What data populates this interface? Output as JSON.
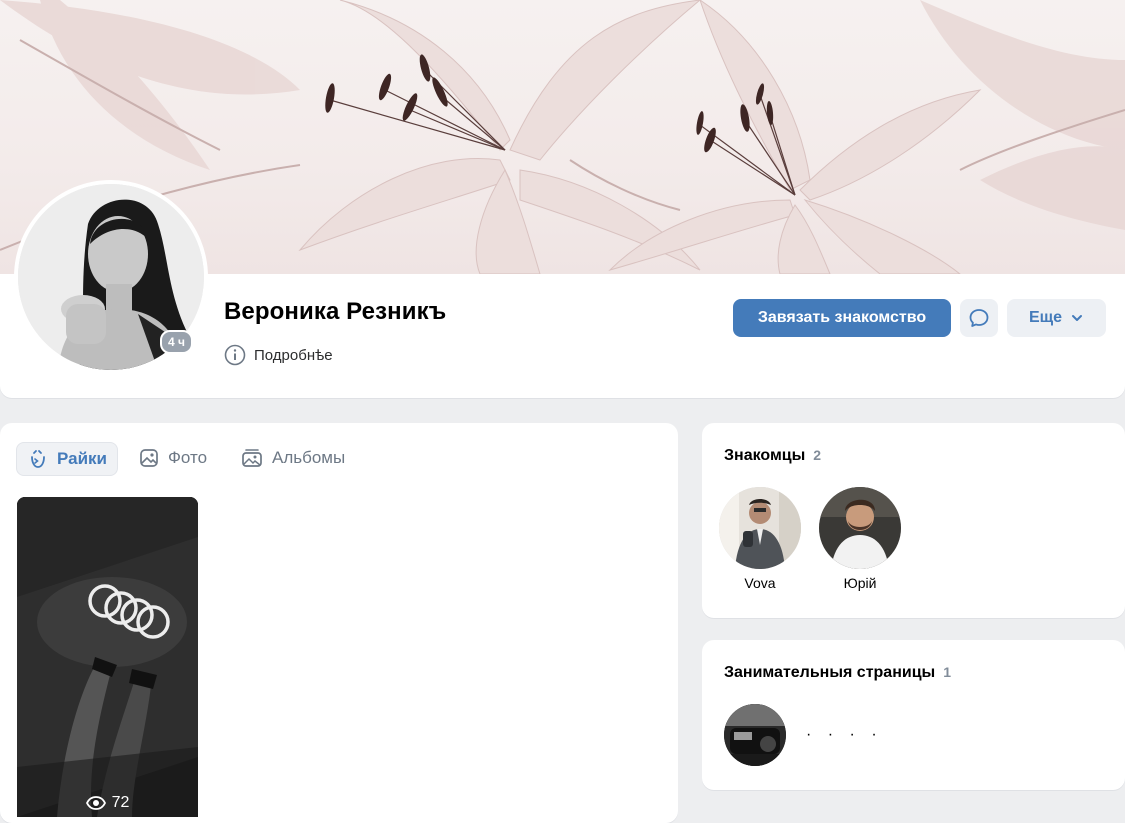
{
  "profile": {
    "name": "Вероника Резникъ",
    "details_label": "Подробнѣе",
    "online_badge": "4 ч",
    "actions": {
      "primary": "Завязать знакомство",
      "more": "Еще"
    }
  },
  "tabs": [
    {
      "label": "Райки",
      "icon": "clips-icon",
      "active": true
    },
    {
      "label": "Фото",
      "icon": "photo-icon",
      "active": false
    },
    {
      "label": "Альбомы",
      "icon": "albums-icon",
      "active": false
    }
  ],
  "clip": {
    "views": "72",
    "icon": "eye-icon"
  },
  "friends": {
    "title": "Знакомцы",
    "count": "2",
    "items": [
      {
        "name": "Vova"
      },
      {
        "name": "Юрій"
      }
    ]
  },
  "pages": {
    "title": "Занимательныя страницы",
    "count": "1",
    "items": [
      {
        "name": "· · · ·"
      }
    ]
  },
  "colors": {
    "accent": "#447bba",
    "secondary_bg": "#edf0f4",
    "page_bg": "#edeef0",
    "muted": "#818c99"
  }
}
